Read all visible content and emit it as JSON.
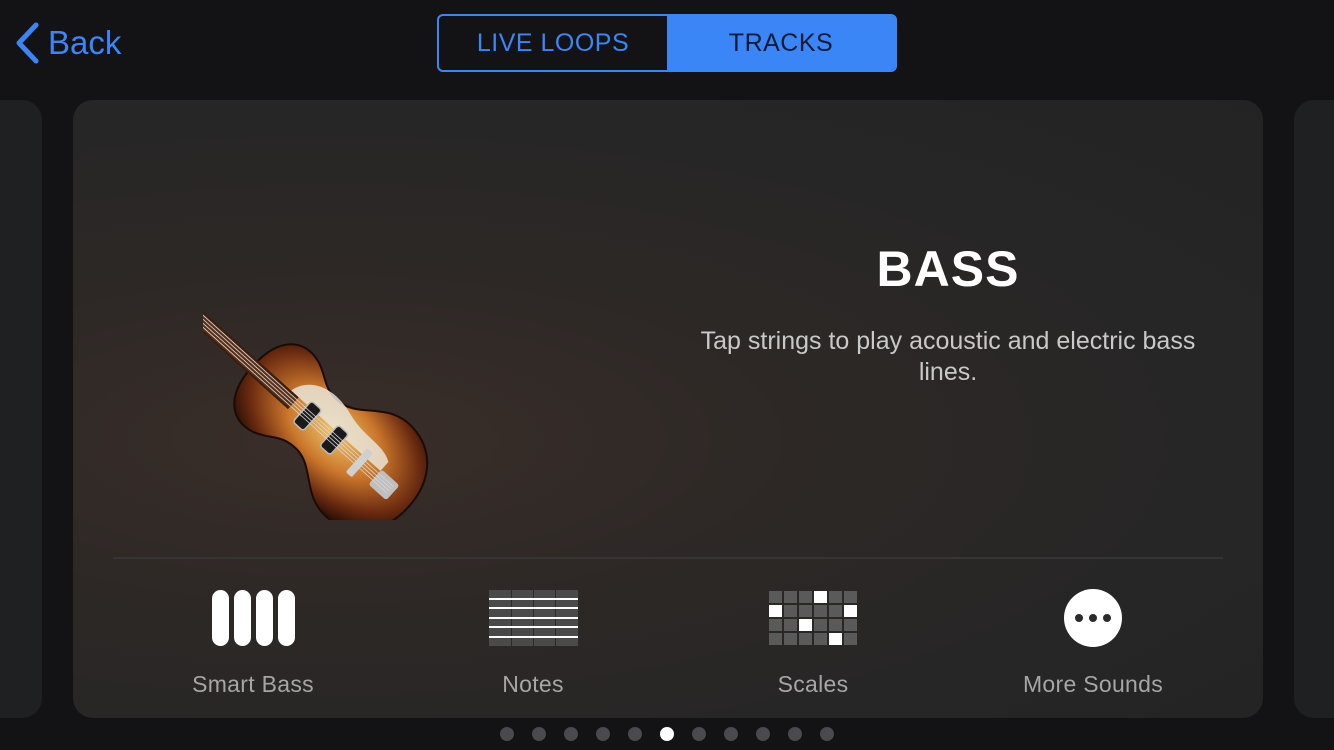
{
  "nav": {
    "back_label": "Back",
    "segments": [
      {
        "label": "LIVE LOOPS",
        "selected": false
      },
      {
        "label": "TRACKS",
        "selected": true
      }
    ]
  },
  "card": {
    "title": "BASS",
    "description": "Tap strings to play acoustic and electric bass lines.",
    "instrument_image": "violin-bass-guitar",
    "options": [
      {
        "label": "Smart Bass",
        "icon": "smart-bass-icon"
      },
      {
        "label": "Notes",
        "icon": "notes-icon"
      },
      {
        "label": "Scales",
        "icon": "scales-icon"
      },
      {
        "label": "More Sounds",
        "icon": "more-icon"
      }
    ]
  },
  "pagination": {
    "total": 11,
    "current": 6
  },
  "colors": {
    "accent": "#3b86f7",
    "background": "#131316",
    "card": "#262626"
  }
}
